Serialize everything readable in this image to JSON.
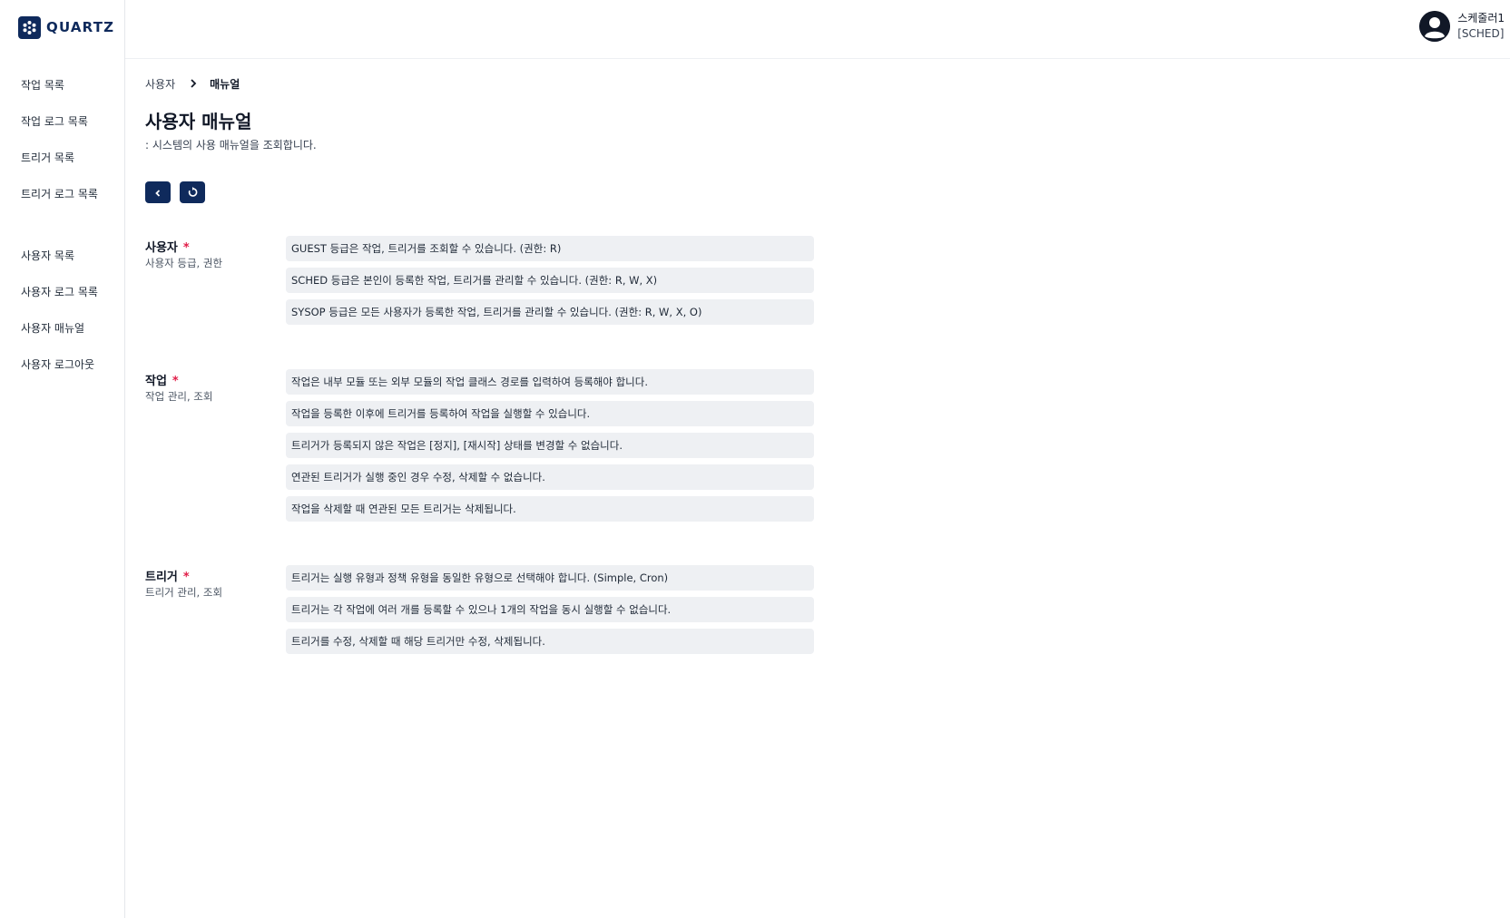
{
  "app": {
    "logo_text": "QUARTZ"
  },
  "sidebar": {
    "items": [
      {
        "label": "작업 목록"
      },
      {
        "label": "작업 로그 목록"
      },
      {
        "label": "트리거 목록"
      },
      {
        "label": "트리거 로그 목록"
      },
      {
        "label": "사용자 목록"
      },
      {
        "label": "사용자 로그 목록"
      },
      {
        "label": "사용자 매뉴얼"
      },
      {
        "label": "사용자 로그아웃"
      }
    ]
  },
  "header": {
    "user_name": "스케줄러1",
    "user_role": "[SCHED]"
  },
  "breadcrumb": {
    "parent": "사용자",
    "current": "매뉴얼"
  },
  "page": {
    "title": "사용자 매뉴얼",
    "description": ": 시스템의 사용 매뉴얼을 조회합니다."
  },
  "toolbar": {
    "back_icon": "chevron-left-icon",
    "refresh_icon": "refresh-icon"
  },
  "sections": [
    {
      "title": "사용자",
      "required_mark": "*",
      "subtitle": "사용자 등급, 권한",
      "rules": [
        "GUEST 등급은 작업, 트리거를 조회할 수 있습니다. (권한: R)",
        "SCHED 등급은 본인이 등록한 작업, 트리거를 관리할 수 있습니다. (권한: R, W, X)",
        "SYSOP 등급은 모든 사용자가 등록한 작업, 트리거를 관리할 수 있습니다. (권한: R, W, X, O)"
      ]
    },
    {
      "title": "작업",
      "required_mark": "*",
      "subtitle": "작업 관리, 조회",
      "rules": [
        "작업은 내부 모듈 또는 외부 모듈의 작업 클래스 경로를 입력하여 등록해야 합니다.",
        "작업을 등록한 이후에 트리거를 등록하여 작업을 실행할 수 있습니다.",
        "트리거가 등록되지 않은 작업은 [정지], [재시작] 상태를 변경할 수 없습니다.",
        "연관된 트리거가 실행 중인 경우 수정, 삭제할 수 없습니다.",
        "작업을 삭제할 때 연관된 모든 트리거는 삭제됩니다."
      ]
    },
    {
      "title": "트리거",
      "required_mark": "*",
      "subtitle": "트리거 관리, 조회",
      "rules": [
        "트리거는 실행 유형과 정책 유형을 동일한 유형으로 선택해야 합니다. (Simple, Cron)",
        "트리거는 각 작업에 여러 개를 등록할 수 있으나 1개의 작업을 동시 실행할 수 없습니다.",
        "트리거를 수정, 삭제할 때 해당 트리거만 수정, 삭제됩니다."
      ]
    }
  ],
  "colors": {
    "brand": "#0f2a5c",
    "required": "#e11d48",
    "rule_bg": "#eef0f3"
  }
}
